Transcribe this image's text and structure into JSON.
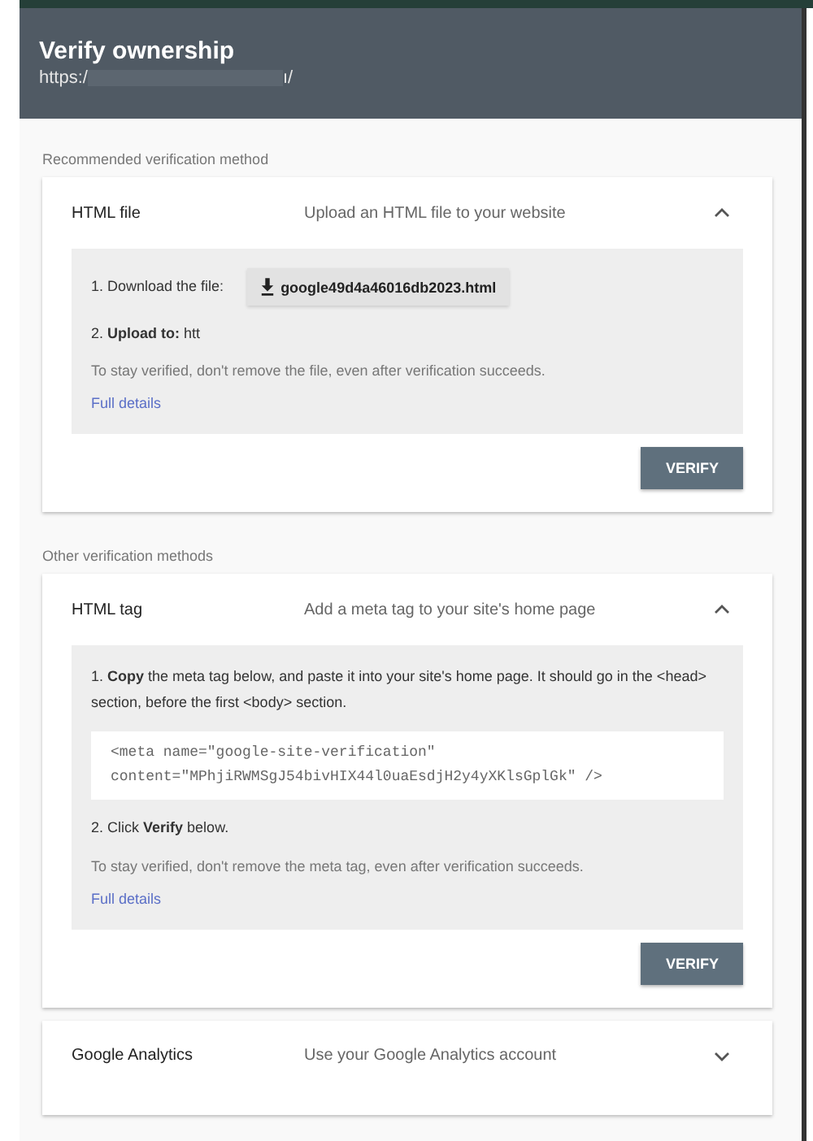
{
  "header": {
    "title": "Verify ownership",
    "url_start": "https:/",
    "url_end": "ı/"
  },
  "sections": [
    {
      "label": "Recommended verification method",
      "methods": [
        {
          "name": "HTML file",
          "description": "Upload an HTML file to your website",
          "expanded": true,
          "button": "VERIFY",
          "steps": [
            {
              "kind": "download",
              "text": "1. Download the file:",
              "file": "google49d4a46016db2023.html"
            },
            {
              "kind": "text",
              "text": "2. **Upload to:** htt"
            },
            {
              "kind": "note",
              "text": "To stay verified, don't remove the file, even after verification succeeds."
            },
            {
              "kind": "link",
              "text": "Full details"
            }
          ]
        }
      ]
    },
    {
      "label": "Other verification methods",
      "methods": [
        {
          "name": "HTML tag",
          "description": "Add a meta tag to your site's home page",
          "expanded": true,
          "button": "VERIFY",
          "steps": [
            {
              "kind": "text",
              "text": "1. **Copy** the meta tag below, and paste it into your site's home page. It should go in the <head> section, before the first <body> section."
            },
            {
              "kind": "code",
              "lines": [
                "<meta name=\"google-site-verification\"",
                "content=\"MPhjiRWMSgJ54bivHIX44l0uaEsdjH2y4yXKlsGplGk\" />"
              ]
            },
            {
              "kind": "text",
              "text": "2. Click **Verify** below."
            },
            {
              "kind": "note",
              "text": "To stay verified, don't remove the meta tag, even after verification succeeds."
            },
            {
              "kind": "link",
              "text": "Full details"
            }
          ]
        },
        {
          "name": "Google Analytics",
          "description": "Use your Google Analytics account",
          "expanded": false
        }
      ]
    }
  ]
}
